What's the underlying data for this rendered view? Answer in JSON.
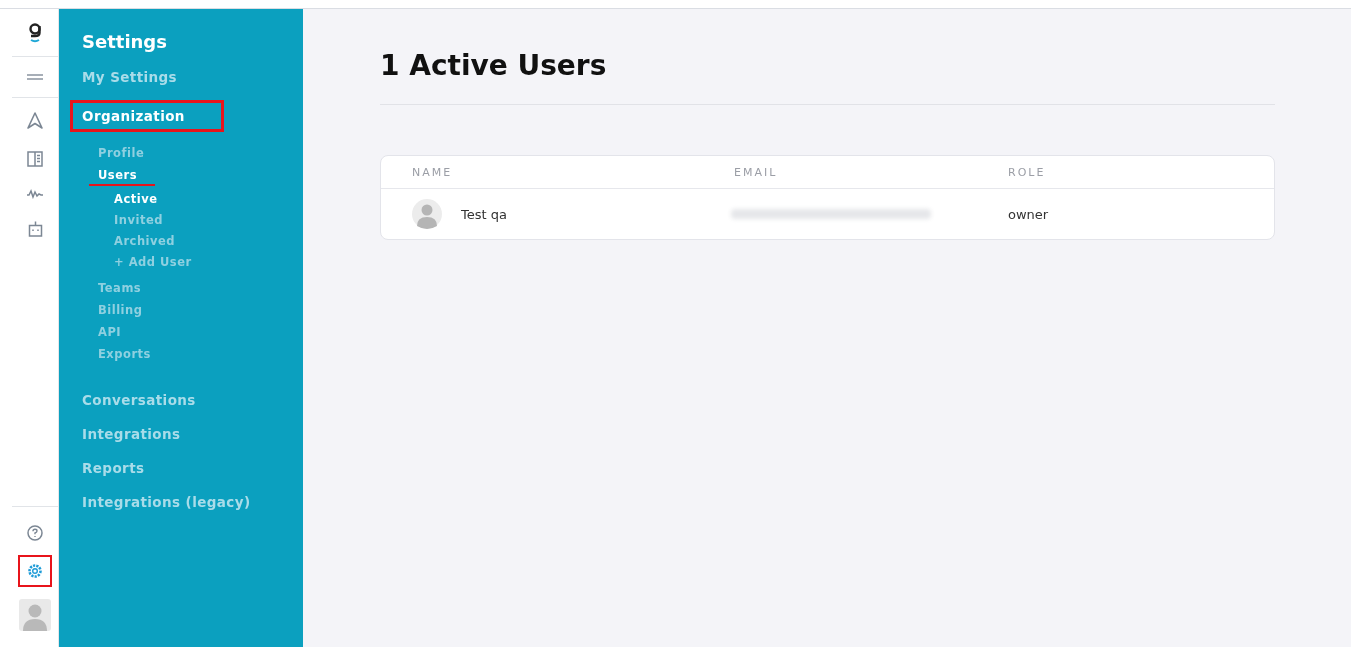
{
  "rail": {
    "top_icons": [
      {
        "kind": "navigate",
        "selected": false
      },
      {
        "kind": "book",
        "selected": false
      },
      {
        "kind": "activity",
        "selected": false
      },
      {
        "kind": "robot",
        "selected": false
      }
    ],
    "bottom_icons": [
      {
        "kind": "help",
        "selected": false,
        "highlighted": false
      },
      {
        "kind": "settings",
        "selected": true,
        "highlighted": true
      }
    ]
  },
  "sidebar": {
    "title": "Settings",
    "items": [
      {
        "label": "My Settings",
        "selected": false,
        "highlighted": false
      },
      {
        "label": "Organization",
        "selected": true,
        "highlighted": true,
        "children": [
          {
            "label": "Profile",
            "selected": false,
            "highlighted": false
          },
          {
            "label": "Users",
            "selected": true,
            "highlighted": true,
            "children": [
              {
                "label": "Active",
                "selected": true
              },
              {
                "label": "Invited",
                "selected": false
              },
              {
                "label": "Archived",
                "selected": false
              },
              {
                "label": "+ Add User",
                "selected": false
              }
            ]
          },
          {
            "label": "Teams",
            "selected": false,
            "highlighted": false
          },
          {
            "label": "Billing",
            "selected": false,
            "highlighted": false
          },
          {
            "label": "API",
            "selected": false,
            "highlighted": false
          },
          {
            "label": "Exports",
            "selected": false,
            "highlighted": false
          }
        ]
      },
      {
        "label": "Conversations",
        "selected": false,
        "highlighted": false
      },
      {
        "label": "Integrations",
        "selected": false,
        "highlighted": false
      },
      {
        "label": "Reports",
        "selected": false,
        "highlighted": false
      },
      {
        "label": "Integrations (legacy)",
        "selected": false,
        "highlighted": false
      }
    ]
  },
  "page": {
    "title": "1 Active Users"
  },
  "table": {
    "columns": [
      "NAME",
      "EMAIL",
      "ROLE"
    ],
    "rows": [
      {
        "name": "Test qa",
        "role": "owner"
      }
    ]
  }
}
